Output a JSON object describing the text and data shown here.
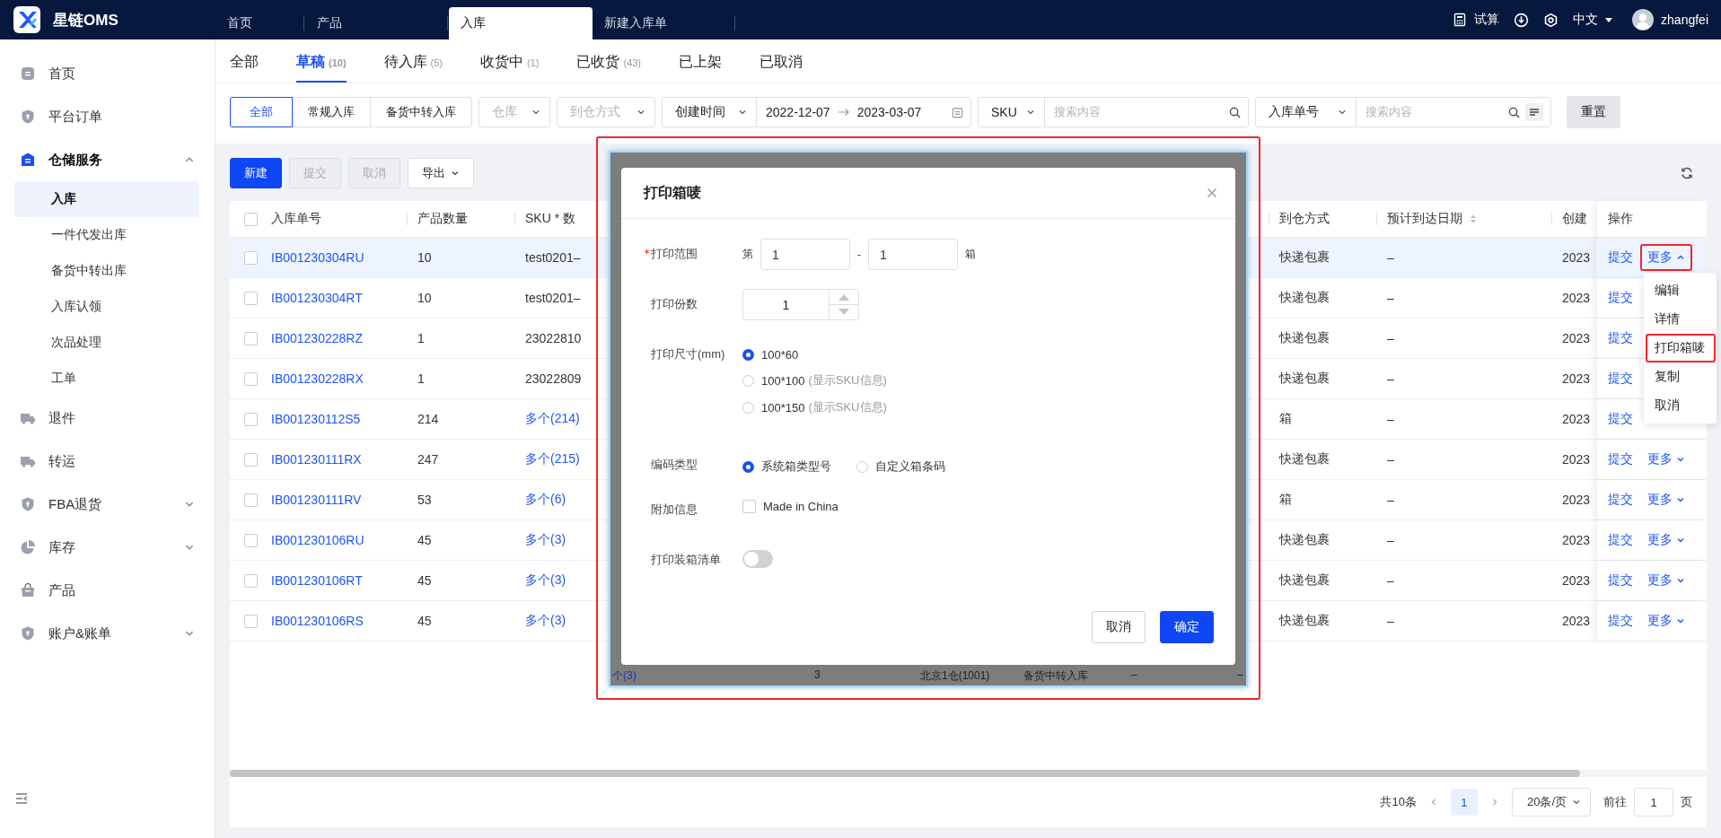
{
  "app": {
    "name": "星链OMS"
  },
  "top_tabs": [
    {
      "label": "首页",
      "selected": false
    },
    {
      "label": "产品",
      "selected": false
    },
    {
      "label": "入库",
      "selected": true
    },
    {
      "label": "新建入库单",
      "selected": false
    }
  ],
  "header": {
    "calculator": "试算",
    "language": "中文",
    "user": "zhangfei"
  },
  "sidebar": {
    "items": [
      {
        "label": "首页",
        "selected": false
      },
      {
        "label": "平台订单",
        "selected": false
      },
      {
        "label": "仓储服务",
        "selected": false,
        "expanded": true,
        "children": [
          {
            "label": "入库",
            "selected": true
          },
          {
            "label": "一件代发出库",
            "selected": false
          },
          {
            "label": "备货中转出库",
            "selected": false
          },
          {
            "label": "入库认领",
            "selected": false
          },
          {
            "label": "次品处理",
            "selected": false
          },
          {
            "label": "工单",
            "selected": false
          }
        ]
      },
      {
        "label": "退件",
        "selected": false
      },
      {
        "label": "转运",
        "selected": false
      },
      {
        "label": "FBA退货",
        "selected": false,
        "expanded": false
      },
      {
        "label": "库存",
        "selected": false,
        "expanded": false
      },
      {
        "label": "产品",
        "selected": false
      },
      {
        "label": "账户&账单",
        "selected": false,
        "expanded": false
      }
    ]
  },
  "status_tabs": [
    {
      "label": "全部",
      "selected": false
    },
    {
      "label": "草稿",
      "count": "(10)",
      "selected": true
    },
    {
      "label": "待入库",
      "count": "(5)",
      "selected": false
    },
    {
      "label": "收货中",
      "count": "(1)",
      "selected": false
    },
    {
      "label": "已收货",
      "count": "(43)",
      "selected": false
    },
    {
      "label": "已上架",
      "selected": false
    },
    {
      "label": "已取消",
      "selected": false
    }
  ],
  "filters": {
    "type_segments": [
      {
        "label": "全部",
        "selected": true
      },
      {
        "label": "常规入库",
        "selected": false
      },
      {
        "label": "备货中转入库",
        "selected": false
      }
    ],
    "warehouse": {
      "placeholder": "仓库"
    },
    "arrival_method": {
      "placeholder": "到仓方式"
    },
    "date_type": "创建时间",
    "date_from": "2022-12-07",
    "date_to": "2023-03-07",
    "sku_search": {
      "type": "SKU",
      "placeholder": "搜索内容"
    },
    "order_search": {
      "type": "入库单号",
      "placeholder": "搜索内容"
    },
    "reset": "重置"
  },
  "toolbar": [
    {
      "label": "新建",
      "kind": "primary",
      "disabled": false
    },
    {
      "label": "提交",
      "kind": "default",
      "disabled": true
    },
    {
      "label": "取消",
      "kind": "default",
      "disabled": true
    },
    {
      "label": "导出",
      "kind": "dropdown",
      "disabled": false
    }
  ],
  "table": {
    "all_checked": false,
    "columns": [
      "入库单号",
      "产品数量",
      "SKU * 数",
      "到仓方式",
      "预计到达日期",
      "创建",
      "操作"
    ],
    "rows": [
      {
        "id": "IB001230304RU",
        "qty": "10",
        "sku": "test0201–",
        "sku_link": false,
        "arrival": "快递包裹",
        "eta": "–",
        "created": "2023",
        "submit": "提交",
        "more": "更多",
        "checked": false,
        "highlighted": true,
        "more_expanded": true,
        "more_outlined": true
      },
      {
        "id": "IB001230304RT",
        "qty": "10",
        "sku": "test0201–",
        "sku_link": false,
        "arrival": "快递包裹",
        "eta": "–",
        "created": "2023",
        "submit": "提交",
        "checked": false,
        "highlighted": false
      },
      {
        "id": "IB001230228RZ",
        "qty": "1",
        "sku": "23022810",
        "sku_link": false,
        "arrival": "快递包裹",
        "eta": "–",
        "created": "2023",
        "submit": "提交",
        "checked": false,
        "highlighted": false
      },
      {
        "id": "IB001230228RX",
        "qty": "1",
        "sku": "23022809",
        "sku_link": false,
        "arrival": "快递包裹",
        "eta": "–",
        "created": "2023",
        "submit": "提交",
        "checked": false,
        "highlighted": false
      },
      {
        "id": "IB001230112S5",
        "qty": "214",
        "sku": "多个(214)",
        "sku_link": true,
        "arrival": "箱",
        "eta": "–",
        "created": "2023",
        "submit": "提交",
        "checked": false,
        "highlighted": false
      },
      {
        "id": "IB001230111RX",
        "qty": "247",
        "sku": "多个(215)",
        "sku_link": true,
        "arrival": "快递包裹",
        "eta": "–",
        "created": "2023",
        "submit": "提交",
        "more": "更多",
        "checked": false,
        "highlighted": false,
        "more_expanded": false,
        "more_outlined": false
      },
      {
        "id": "IB001230111RV",
        "qty": "53",
        "sku": "多个(6)",
        "sku_link": true,
        "arrival": "箱",
        "eta": "–",
        "created": "2023",
        "submit": "提交",
        "more": "更多",
        "checked": false,
        "highlighted": false,
        "more_expanded": false,
        "more_outlined": false
      },
      {
        "id": "IB001230106RU",
        "qty": "45",
        "sku": "多个(3)",
        "sku_link": true,
        "arrival": "快递包裹",
        "eta": "–",
        "created": "2023",
        "submit": "提交",
        "more": "更多",
        "checked": false,
        "highlighted": false,
        "more_expanded": false,
        "more_outlined": false
      },
      {
        "id": "IB001230106RT",
        "qty": "45",
        "sku": "多个(3)",
        "sku_link": true,
        "arrival": "快递包裹",
        "eta": "–",
        "created": "2023",
        "submit": "提交",
        "more": "更多",
        "checked": false,
        "highlighted": false,
        "more_expanded": false,
        "more_outlined": false
      },
      {
        "id": "IB001230106RS",
        "qty": "45",
        "sku": "多个(3)",
        "sku_link": true,
        "arrival": "快递包裹",
        "eta": "–",
        "created": "2023",
        "submit": "提交",
        "more": "更多",
        "checked": false,
        "highlighted": false,
        "more_expanded": false,
        "more_outlined": false
      }
    ]
  },
  "row_menu": [
    {
      "label": "编辑",
      "outlined": false
    },
    {
      "label": "详情",
      "outlined": false
    },
    {
      "label": "打印箱唛",
      "outlined": true
    },
    {
      "label": "复制",
      "outlined": false
    },
    {
      "label": "取消",
      "outlined": false
    }
  ],
  "pagination": {
    "total": "共10条",
    "pages": [
      {
        "label": "1",
        "selected": true
      }
    ],
    "page_size": "20条/页",
    "goto_label": "前往",
    "goto_value": "1",
    "goto_suffix": "页"
  },
  "dialog": {
    "title": "打印箱唛",
    "fields": [
      {
        "kind": "range",
        "label": "打印范围",
        "required": true,
        "prefix": "第",
        "from": "1",
        "separator": "-",
        "to": "1",
        "suffix": "箱"
      },
      {
        "kind": "number",
        "label": "打印份数",
        "required": false,
        "value": "1"
      },
      {
        "kind": "radio",
        "label": "打印尺寸(mm)",
        "required": false,
        "options": [
          {
            "label": "100*60",
            "selected": true
          },
          {
            "label": "100*100",
            "note": "(显示SKU信息)",
            "selected": false
          },
          {
            "label": "100*150",
            "note": "(显示SKU信息)",
            "selected": false
          }
        ]
      },
      {
        "kind": "radio",
        "label": "编码类型",
        "required": false,
        "options": [
          {
            "label": "系统箱类型号",
            "selected": true
          },
          {
            "label": "自定义箱条码",
            "selected": false
          }
        ]
      },
      {
        "kind": "checkbox",
        "label": "附加信息",
        "required": false,
        "option": "Made in China",
        "checked": false
      },
      {
        "kind": "switch",
        "label": "打印装箱清单",
        "required": false,
        "on": false
      }
    ],
    "buttons": [
      {
        "label": "取消",
        "kind": "default"
      },
      {
        "label": "确定",
        "kind": "primary"
      }
    ],
    "backdrop_row": [
      "个(3)",
      "3",
      "北京1仓(1001)",
      "备货中转入库",
      "–",
      "–"
    ]
  }
}
